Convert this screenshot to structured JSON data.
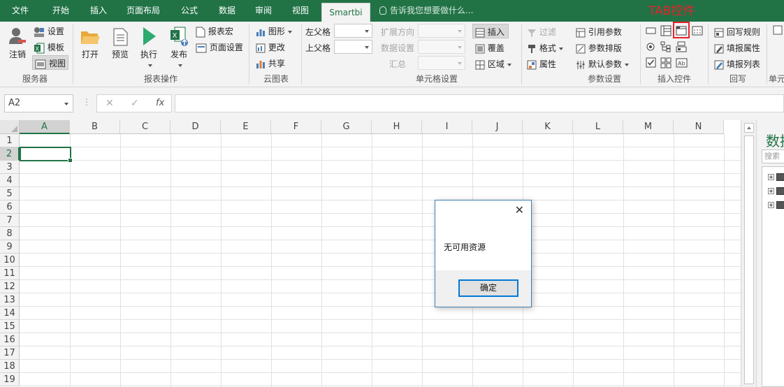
{
  "tabs": [
    {
      "label": "文件"
    },
    {
      "label": "开始"
    },
    {
      "label": "插入"
    },
    {
      "label": "页面布局"
    },
    {
      "label": "公式"
    },
    {
      "label": "数据"
    },
    {
      "label": "审阅"
    },
    {
      "label": "视图"
    },
    {
      "label": "Smartbi"
    }
  ],
  "tell_me": "告诉我您想要做什么...",
  "annotation": "TAB控件",
  "ribbon": {
    "server": {
      "login": "注销",
      "settings": "设置",
      "template": "模板",
      "view": "视图",
      "label": "服务器"
    },
    "report_ops": {
      "open": "打开",
      "preview": "预览",
      "execute": "执行",
      "publish": "发布",
      "macro": "报表宏",
      "page_setup": "页面设置",
      "label": "报表操作"
    },
    "cloud": {
      "chart": "图形",
      "change": "更改",
      "share": "共享",
      "label": "云图表"
    },
    "cell_settings": {
      "left_parent": "左父格",
      "top_parent": "上父格",
      "expand_dir": "扩展方向",
      "data_settings": "数据设置",
      "summary": "汇总",
      "insert": "插入",
      "overwrite": "覆盖",
      "region": "区域",
      "label": "单元格设置"
    },
    "params": {
      "filter": "过滤",
      "format": "格式",
      "property": "属性",
      "ref_param": "引用参数",
      "param_layout": "参数排版",
      "default_param": "默认参数",
      "label": "参数设置"
    },
    "insert_controls": {
      "label": "插入控件"
    },
    "writeback": {
      "rule": "回写规则",
      "fill_prop": "填报属性",
      "fill_list": "填报列表",
      "label": "回写"
    },
    "cell_clipped": {
      "label": "单元"
    }
  },
  "formula_bar": {
    "name_box": "A2",
    "cancel": "✕",
    "enter": "✓",
    "fx": "fx",
    "content": ""
  },
  "columns": [
    "A",
    "B",
    "C",
    "D",
    "E",
    "F",
    "G",
    "H",
    "I",
    "J",
    "K",
    "L",
    "M",
    "N"
  ],
  "rows": [
    "1",
    "2",
    "3",
    "4",
    "5",
    "6",
    "7",
    "8",
    "9",
    "10",
    "11",
    "12",
    "13",
    "14",
    "15",
    "16",
    "17",
    "18",
    "19"
  ],
  "selected_cell": "A2",
  "pane": {
    "title": "数据",
    "search_placeholder": "搜索"
  },
  "dialog": {
    "message": "无可用资源",
    "ok": "确定",
    "close": "✕"
  },
  "colors": {
    "brand_green": "#217346",
    "annotation_red": "#e8212c",
    "dialog_border": "#3c7fb1"
  }
}
